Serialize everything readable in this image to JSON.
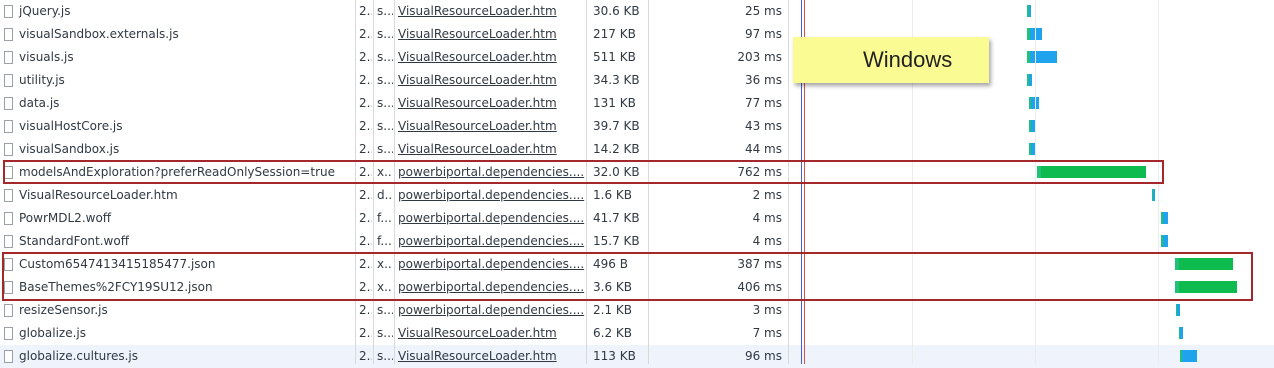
{
  "annotation": {
    "label": "Windows"
  },
  "rows": [
    {
      "name": "jQuery.js",
      "status": "2..",
      "type": "s...",
      "initiator": "VisualResourceLoader.htm",
      "size": "30.6 KB",
      "time": "25 ms",
      "bar_kind": "js"
    },
    {
      "name": "visualSandbox.externals.js",
      "status": "2..",
      "type": "s...",
      "initiator": "VisualResourceLoader.htm",
      "size": "217 KB",
      "time": "97 ms",
      "bar_kind": "js"
    },
    {
      "name": "visuals.js",
      "status": "2..",
      "type": "s...",
      "initiator": "VisualResourceLoader.htm",
      "size": "511 KB",
      "time": "203 ms",
      "bar_kind": "js"
    },
    {
      "name": "utility.js",
      "status": "2..",
      "type": "s...",
      "initiator": "VisualResourceLoader.htm",
      "size": "34.3 KB",
      "time": "36 ms",
      "bar_kind": "js"
    },
    {
      "name": "data.js",
      "status": "2..",
      "type": "s...",
      "initiator": "VisualResourceLoader.htm",
      "size": "131 KB",
      "time": "77 ms",
      "bar_kind": "js"
    },
    {
      "name": "visualHostCore.js",
      "status": "2..",
      "type": "s...",
      "initiator": "VisualResourceLoader.htm",
      "size": "39.7 KB",
      "time": "43 ms",
      "bar_kind": "js"
    },
    {
      "name": "visualSandbox.js",
      "status": "2..",
      "type": "s...",
      "initiator": "VisualResourceLoader.htm",
      "size": "14.2 KB",
      "time": "44 ms",
      "bar_kind": "js"
    },
    {
      "name": "modelsAndExploration?preferReadOnlySession=true",
      "status": "2..",
      "type": "x...",
      "initiator": "powerbiportal.dependencies....",
      "size": "32.0 KB",
      "time": "762 ms",
      "bar_kind": "json"
    },
    {
      "name": "VisualResourceLoader.htm",
      "status": "2..",
      "type": "d...",
      "initiator": "powerbiportal.dependencies....",
      "size": "1.6 KB",
      "time": "2 ms",
      "bar_kind": "js"
    },
    {
      "name": "PowrMDL2.woff",
      "status": "2..",
      "type": "f...",
      "initiator": "powerbiportal.dependencies....",
      "size": "41.7 KB",
      "time": "4 ms",
      "bar_kind": "js"
    },
    {
      "name": "StandardFont.woff",
      "status": "2..",
      "type": "f...",
      "initiator": "powerbiportal.dependencies....",
      "size": "15.7 KB",
      "time": "4 ms",
      "bar_kind": "js"
    },
    {
      "name": "Custom6547413415185477.json",
      "status": "2..",
      "type": "x...",
      "initiator": "powerbiportal.dependencies....",
      "size": "496 B",
      "time": "387 ms",
      "bar_kind": "json"
    },
    {
      "name": "BaseThemes%2FCY19SU12.json",
      "status": "2..",
      "type": "x...",
      "initiator": "powerbiportal.dependencies....",
      "size": "3.6 KB",
      "time": "406 ms",
      "bar_kind": "json"
    },
    {
      "name": "resizeSensor.js",
      "status": "2..",
      "type": "s...",
      "initiator": "powerbiportal.dependencies....",
      "size": "2.1 KB",
      "time": "3 ms",
      "bar_kind": "js"
    },
    {
      "name": "globalize.js",
      "status": "2..",
      "type": "s...",
      "initiator": "VisualResourceLoader.htm",
      "size": "6.2 KB",
      "time": "7 ms",
      "bar_kind": "js"
    },
    {
      "name": "globalize.cultures.js",
      "status": "2..",
      "type": "s...",
      "initiator": "VisualResourceLoader.htm",
      "size": "113 KB",
      "time": "96 ms",
      "bar_kind": "js"
    }
  ],
  "colors": {
    "waiting": "#21c17a",
    "download": "#1fa3ec",
    "json": "#0dbb4f",
    "highlight": "#a3272b",
    "tooltip": "#fbfb93"
  }
}
